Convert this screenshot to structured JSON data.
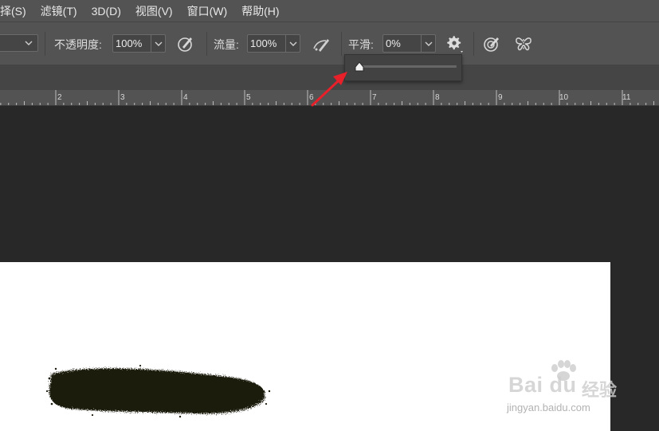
{
  "menubar": {
    "items": [
      {
        "id": "select",
        "label": "择(S)"
      },
      {
        "id": "filter",
        "label": "滤镜(T)"
      },
      {
        "id": "3d",
        "label": "3D(D)"
      },
      {
        "id": "view",
        "label": "视图(V)"
      },
      {
        "id": "window",
        "label": "窗口(W)"
      },
      {
        "id": "help",
        "label": "帮助(H)"
      }
    ]
  },
  "options": {
    "opacity_label": "不透明度:",
    "opacity_value": "100%",
    "flow_label": "流量:",
    "flow_value": "100%",
    "smoothing_label": "平滑:",
    "smoothing_value": "0%"
  },
  "smoothing_popup": {
    "value_percent": 0
  },
  "ruler": {
    "labels": [
      "2",
      "3",
      "4",
      "5",
      "6",
      "7",
      "8",
      "9",
      "10",
      "11"
    ]
  },
  "watermark": {
    "brand": "Bai du",
    "brand_cn": "经验",
    "url": "jingyan.baidu.com"
  },
  "colors": {
    "menubar_bg": "#535353",
    "workspace_bg": "#282828",
    "canvas_bg": "#ffffff",
    "stroke": "#1c1a0d",
    "arrow": "#e8202a"
  },
  "icons": [
    "chevron-down-icon",
    "airbrush-pressure-icon",
    "airbrush-icon",
    "gear-icon",
    "pressure-size-icon",
    "symmetry-butterfly-icon"
  ]
}
